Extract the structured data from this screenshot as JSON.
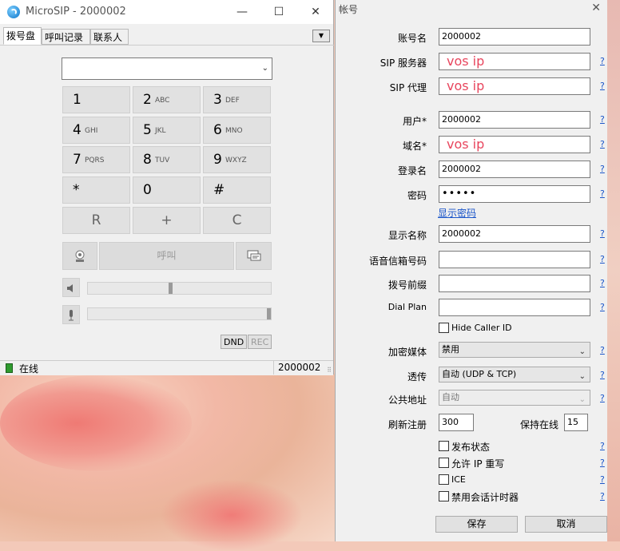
{
  "microsip": {
    "title": "MicroSIP - 2000002",
    "window_buttons": {
      "minimize": "—",
      "maximize": "☐",
      "close": "✕"
    },
    "tabs": [
      "拨号盘",
      "呼叫记录",
      "联系人"
    ],
    "tab_menu": "▼",
    "keys": [
      {
        "digit": "1",
        "letters": ""
      },
      {
        "digit": "2",
        "letters": "ABC"
      },
      {
        "digit": "3",
        "letters": "DEF"
      },
      {
        "digit": "4",
        "letters": "GHI"
      },
      {
        "digit": "5",
        "letters": "JKL"
      },
      {
        "digit": "6",
        "letters": "MNO"
      },
      {
        "digit": "7",
        "letters": "PQRS"
      },
      {
        "digit": "8",
        "letters": "TUV"
      },
      {
        "digit": "9",
        "letters": "WXYZ"
      },
      {
        "digit": "*",
        "letters": ""
      },
      {
        "digit": "0",
        "letters": ""
      },
      {
        "digit": "#",
        "letters": ""
      }
    ],
    "action_keys": {
      "redial": "R",
      "plus": "+",
      "clear": "C"
    },
    "call_label": "呼叫",
    "speaker_level": 0.45,
    "mic_level": 1.0,
    "dnd_label": "DND",
    "rec_label": "REC",
    "status_text": "在线",
    "status_color": "#2f9b2f",
    "status_number": "2000002"
  },
  "account": {
    "title": "帐号",
    "fields": {
      "account_name": {
        "label": "账号名",
        "value": "2000002"
      },
      "sip_server": {
        "label": "SIP 服务器",
        "value": "vos ip"
      },
      "sip_proxy": {
        "label": "SIP 代理",
        "value": "vos ip"
      },
      "user": {
        "label": "用户*",
        "value": "2000002"
      },
      "domain": {
        "label": "域名*",
        "value": "vos ip"
      },
      "login": {
        "label": "登录名",
        "value": "2000002"
      },
      "password": {
        "label": "密码",
        "value": "•••••"
      },
      "display_name": {
        "label": "显示名称",
        "value": "2000002"
      },
      "voicemail": {
        "label": "语音信箱号码",
        "value": ""
      },
      "dial_prefix": {
        "label": "拨号前缀",
        "value": ""
      },
      "dial_plan": {
        "label": "Dial Plan",
        "value": ""
      }
    },
    "show_password": "显示密码",
    "hide_caller_id": "Hide Caller ID",
    "encryption": {
      "label": "加密媒体",
      "value": "禁用"
    },
    "transport": {
      "label": "透传",
      "value": "自动 (UDP & TCP)"
    },
    "public_address": {
      "label": "公共地址",
      "value": "自动"
    },
    "register_refresh": {
      "label": "刷新注册",
      "value": "300"
    },
    "keep_alive": {
      "label": "保持在线",
      "value": "15"
    },
    "publish_presence": "发布状态",
    "allow_ip_rewrite": "允许 IP 重写",
    "ice": "ICE",
    "disable_session_timer": "禁用会话计时器",
    "help": "?",
    "save": "保存",
    "cancel": "取消",
    "highlight_color": "#e8455d",
    "link_color": "#1a55c9"
  }
}
